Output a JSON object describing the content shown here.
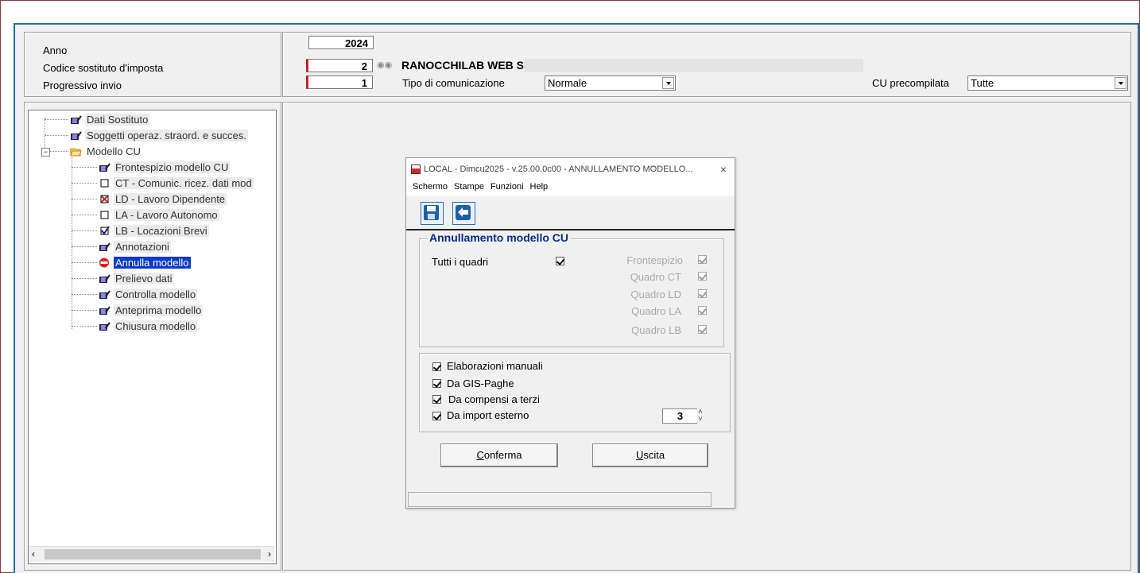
{
  "header": {
    "anno_label": "Anno",
    "anno_value": "2024",
    "codice_label": "Codice sostituto d'imposta",
    "codice_value": "2",
    "company_name": "RANOCCHILAB WEB SRL",
    "progressivo_label": "Progressivo invio",
    "progressivo_value": "1",
    "tipo_label": "Tipo di comunicazione",
    "tipo_value": "Normale",
    "cu_precompilata_label": "CU precompilata",
    "cu_precompilata_value": "Tutte"
  },
  "tree": {
    "items": [
      {
        "label": "Dati Sostituto",
        "icon": "edit-grid-icon"
      },
      {
        "label": "Soggetti operaz. straord. e succes.",
        "icon": "edit-grid-icon"
      },
      {
        "label": "Modello CU",
        "icon": "folder-open-icon"
      },
      {
        "label": "Frontespizio modello CU",
        "icon": "edit-grid-icon"
      },
      {
        "label": "CT - Comunic. ricez. dati mod",
        "icon": "checkbox-empty-icon"
      },
      {
        "label": "LD - Lavoro Dipendente",
        "icon": "checkbox-x-red-icon"
      },
      {
        "label": "LA - Lavoro Autonomo",
        "icon": "checkbox-empty-icon"
      },
      {
        "label": "LB - Locazioni Brevi",
        "icon": "checkbox-checked-icon"
      },
      {
        "label": "Annotazioni",
        "icon": "edit-grid-icon"
      },
      {
        "label": "Annulla modello",
        "icon": "no-entry-icon"
      },
      {
        "label": "Prelievo dati",
        "icon": "edit-grid-icon"
      },
      {
        "label": "Controlla modello",
        "icon": "edit-grid-icon"
      },
      {
        "label": "Anteprima modello",
        "icon": "edit-grid-icon"
      },
      {
        "label": "Chiusura modello",
        "icon": "edit-grid-icon"
      }
    ]
  },
  "dialog": {
    "title": "LOCAL - Dimcu2025 - v.25.00.0c00 - ANNULLAMENTO MODELLO...",
    "menu": [
      "Schermo",
      "Stampe",
      "Funzioni",
      "Help"
    ],
    "toolbar": {
      "save_icon": "save-icon",
      "exit_icon": "back-icon"
    },
    "group1_title": "Annullamento modello CU",
    "tutti_label": "Tutti i quadri",
    "tutti_checked": true,
    "quadri": [
      {
        "label": "Frontespizio",
        "checked": true
      },
      {
        "label": "Quadro CT",
        "checked": true
      },
      {
        "label": "Quadro LD",
        "checked": true
      },
      {
        "label": "Quadro LA",
        "checked": true
      },
      {
        "label": "Quadro LB",
        "checked": true
      }
    ],
    "options": [
      {
        "label": "Elaborazioni manuali",
        "checked": true
      },
      {
        "label": "Da GIS-Paghe",
        "checked": true
      },
      {
        "label": "Da compensi a terzi",
        "checked": true
      },
      {
        "label": "Da import esterno",
        "checked": true
      }
    ],
    "import_value": "3",
    "confirm_pre": "",
    "confirm_underline": "C",
    "confirm_rest": "onferma",
    "exit_underline": "U",
    "exit_rest": "scita"
  },
  "colors": {
    "accent_blue": "#1d6fb8",
    "selection": "#0a3acf",
    "required_red": "#d21f1f"
  }
}
